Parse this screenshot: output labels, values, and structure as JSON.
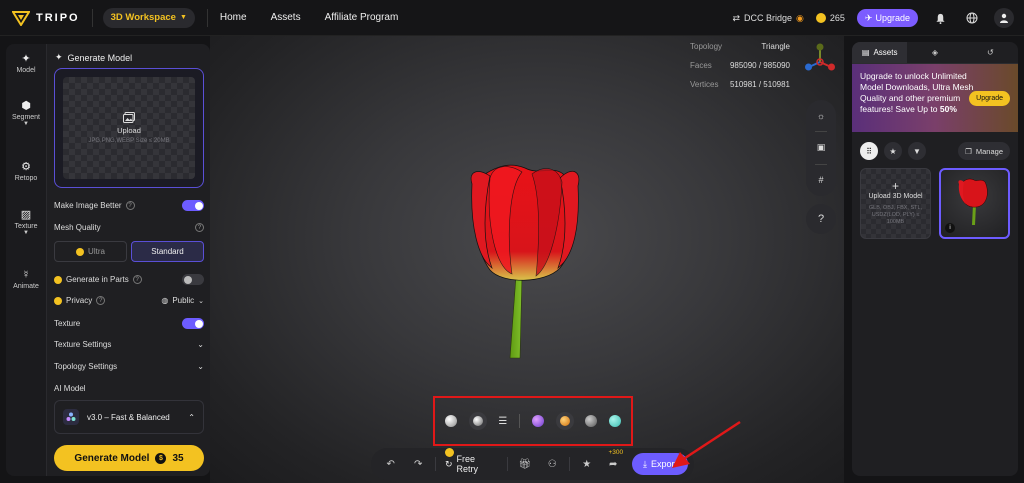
{
  "topbar": {
    "brand": "TRIPO",
    "workspace": "3D Workspace",
    "nav": [
      "Home",
      "Assets",
      "Affiliate Program"
    ],
    "dcc_bridge": "DCC Bridge",
    "credits": "265",
    "upgrade": "Upgrade"
  },
  "rail": {
    "items": [
      {
        "label": "Model",
        "icon": "sparkle-icon"
      },
      {
        "label": "Segment",
        "icon": "cube-icon"
      },
      {
        "label": "Retopo",
        "icon": "mesh-icon"
      },
      {
        "label": "Texture",
        "icon": "brush-icon"
      },
      {
        "label": "Animate",
        "icon": "figure-icon"
      }
    ]
  },
  "panel": {
    "title": "Generate Model",
    "upload_label": "Upload",
    "upload_hint": "JPG,PNG,WEBP Size ≤ 20MB",
    "make_image_better": "Make Image Better",
    "mesh_quality": "Mesh Quality",
    "quality_ultra": "Ultra",
    "quality_standard": "Standard",
    "generate_in_parts": "Generate in Parts",
    "privacy": "Privacy",
    "privacy_value": "Public",
    "texture": "Texture",
    "texture_settings": "Texture Settings",
    "topology_settings": "Topology Settings",
    "ai_model": "AI Model",
    "model_name": "v3.0 – Fast & Balanced",
    "generate_button": "Generate Model",
    "generate_cost": "35"
  },
  "stats": {
    "topology_label": "Topology",
    "topology_value": "Triangle",
    "faces_label": "Faces",
    "faces_value": "985090 / 985090",
    "vertices_label": "Vertices",
    "vertices_value": "510981 / 510981"
  },
  "viewport": {
    "help": "?",
    "materials": [
      "#d9d9d9",
      "#bdbdbd",
      "#ffffff",
      "#a86bff",
      "#f29b1e",
      "#9b9b9b",
      "#5fd3c8"
    ]
  },
  "bottom_bar": {
    "free_retry": "Free Retry",
    "plus_badge": "+300",
    "export": "Export"
  },
  "right_panel": {
    "tab_assets": "Assets",
    "promo_text": "Upgrade to unlock Unlimited Model Downloads, Ultra Mesh Quality and other premium features!  Save Up to",
    "promo_bold": "50%",
    "promo_button": "Upgrade",
    "manage": "Manage",
    "upload_3d": "Upload 3D Model",
    "upload_3d_hint": "GLB, OBJ, FBX, STL, USDZ(LOD, PLY) ≤ 100MB"
  }
}
